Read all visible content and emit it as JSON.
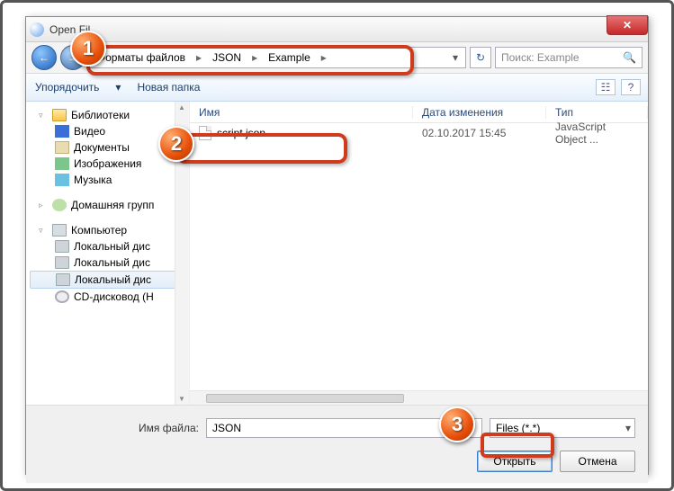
{
  "window": {
    "title": "Open Fil"
  },
  "breadcrumb": {
    "seg1": "Форматы файлов",
    "seg2": "JSON",
    "seg3": "Example"
  },
  "search": {
    "placeholder": "Поиск: Example"
  },
  "toolbar": {
    "organize": "Упорядочить",
    "newfolder": "Новая папка"
  },
  "sidebar": {
    "libs": "Библиотеки",
    "video": "Видео",
    "docs": "Документы",
    "images": "Изображения",
    "music": "Музыка",
    "homegroup": "Домашняя групп",
    "computer": "Компьютер",
    "disk1": "Локальный дис",
    "disk2": "Локальный дис",
    "disk3": "Локальный дис",
    "cd": "CD-дисковод (H"
  },
  "columns": {
    "name": "Имя",
    "date": "Дата изменения",
    "type": "Тип"
  },
  "files": [
    {
      "name": "script.json",
      "date": "02.10.2017 15:45",
      "type": "JavaScript Object ..."
    }
  ],
  "footer": {
    "filename_label": "Имя файла:",
    "filename_value": "JSON",
    "filter": "Files (*.*)",
    "open": "Открыть",
    "cancel": "Отмена"
  },
  "badges": {
    "b1": "1",
    "b2": "2",
    "b3": "3"
  }
}
